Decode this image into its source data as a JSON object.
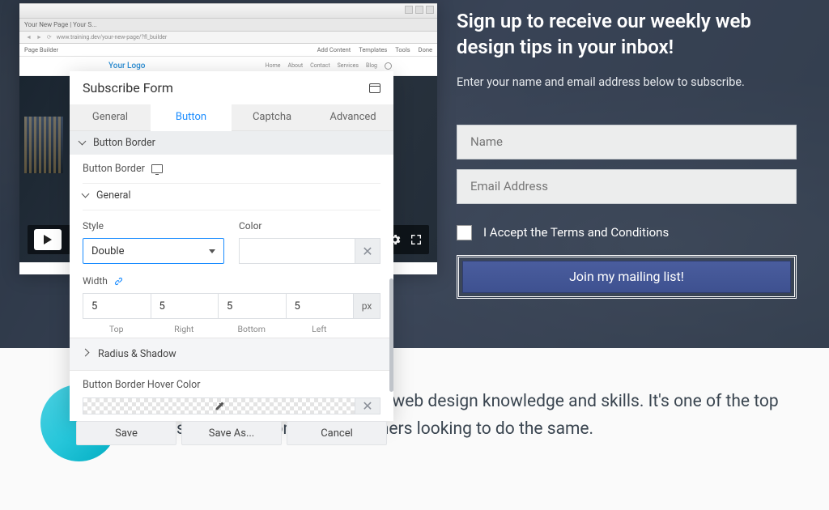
{
  "hero": {
    "title": "Sign up to receive our weekly web design tips in your inbox!",
    "subtitle": "Enter your name and email address below to subscribe.",
    "name_placeholder": "Name",
    "email_placeholder": "Email Address",
    "terms_label": "I Accept the Terms and Conditions",
    "submit_label": "Join my mailing list!"
  },
  "testimonial": {
    "text": "o when it comes to honing my web design knowledge and skills. It's one of the top resources I recommend to others looking to do the same."
  },
  "browser": {
    "tab_title": "Your New Page | Your S...",
    "url": "www.training.dev/your-new-page/?fl_builder",
    "menu": {
      "page_builder": "Page Builder",
      "add_content": "Add Content",
      "templates": "Templates",
      "tools": "Tools",
      "done": "Done"
    },
    "pb": {
      "logo": "Your Logo",
      "nav": [
        "Home",
        "About",
        "Contact",
        "Services",
        "Blog"
      ]
    }
  },
  "panel": {
    "title": "Subscribe Form",
    "tabs": {
      "general": "General",
      "button": "Button",
      "captcha": "Captcha",
      "advanced": "Advanced"
    },
    "section_button_border": "Button Border",
    "row_button_border": "Button Border",
    "general_header": "General",
    "style_label": "Style",
    "style_value": "Double",
    "color_label": "Color",
    "width_label": "Width",
    "width": {
      "top": "5",
      "right": "5",
      "bottom": "5",
      "left": "5",
      "unit": "px",
      "top_caption": "Top",
      "right_caption": "Right",
      "bottom_caption": "Bottom",
      "left_caption": "Left"
    },
    "radius_shadow": "Radius & Shadow",
    "hover_color_label": "Button Border Hover Color",
    "footer": {
      "save": "Save",
      "save_as": "Save As...",
      "cancel": "Cancel"
    }
  }
}
